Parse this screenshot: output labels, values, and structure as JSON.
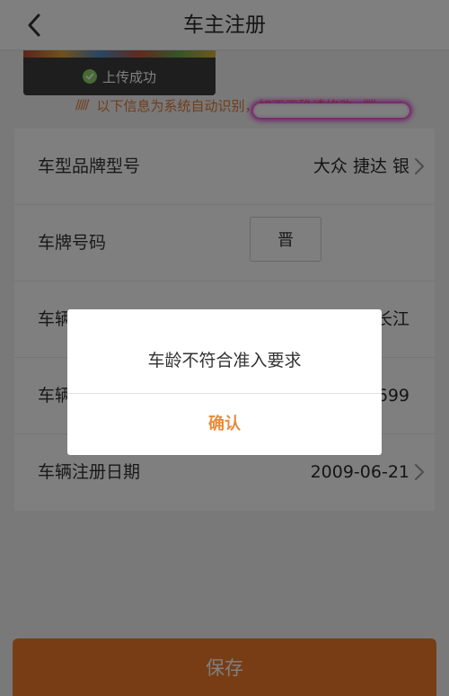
{
  "header": {
    "title": "车主注册",
    "back_icon": "chevron-left-icon"
  },
  "upload": {
    "status": "上传成功",
    "icon": "check-circle-icon",
    "status_color": "#8ed46a"
  },
  "notice": {
    "text": "以下信息为系统自动识别，如不正确请修改",
    "decoration_left": "/////",
    "decoration_right": "/////",
    "color": "#e07b3a"
  },
  "form": {
    "rows": [
      {
        "label": "车型品牌型号",
        "value": "大众 捷达 银",
        "chevron": true
      },
      {
        "label": "车牌号码",
        "prefix": "晋",
        "value": "",
        "redacted": true
      },
      {
        "label": "车辆",
        "value": "长江",
        "chevron": false
      },
      {
        "label": "车辆",
        "value": "699",
        "chevron": false
      },
      {
        "label": "车辆注册日期",
        "value": "2009-06-21",
        "chevron": true
      }
    ]
  },
  "actions": {
    "save_label": "保存",
    "accent": "#f07a2a"
  },
  "dialog": {
    "message": "车龄不符合准入要求",
    "confirm_label": "确认",
    "confirm_color": "#e98a3c"
  }
}
